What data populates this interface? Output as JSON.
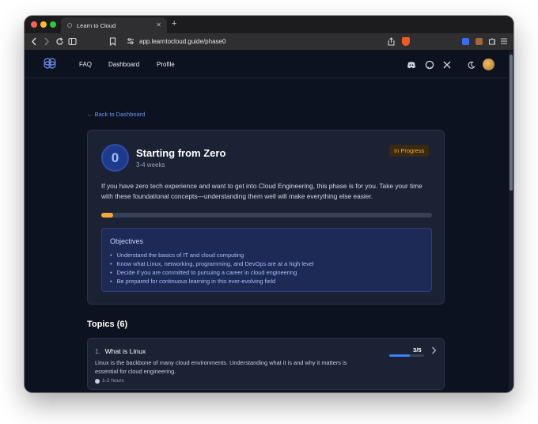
{
  "browser": {
    "tab_title": "Learn to Cloud",
    "url": "app.learntocloud.guide/phase0"
  },
  "nav": {
    "links": [
      "FAQ",
      "Dashboard",
      "Profile"
    ]
  },
  "page": {
    "back_link": "← Back to Dashboard",
    "phase": {
      "number": "0",
      "title": "Starting from Zero",
      "duration": "3-4 weeks",
      "status": "In Progress",
      "description": "If you have zero tech experience and want to get into Cloud Engineering, this phase is for you. Take your time with these foundational concepts—understanding them well will make everything else easier.",
      "progress": 0.035
    },
    "objectives": {
      "title": "Objectives",
      "items": [
        "Understand the basics of IT and cloud computing",
        "Know what Linux, networking, programming, and DevOps are at a high level",
        "Decide if you are committed to pursuing a career in cloud engineering",
        "Be prepared for continuous learning in this ever-evolving field"
      ]
    },
    "topics": {
      "heading": "Topics (6)",
      "items": [
        {
          "number": "1.",
          "title": "What is Linux",
          "description": "Linux is the backbone of many cloud environments. Understanding what it is and why it matters is essential for cloud engineering.",
          "time": "1-2 hours",
          "count": "3/5",
          "progress": 0.6
        }
      ]
    }
  },
  "colors": {
    "accent": "#f2a93b",
    "link": "#6b93f5",
    "background": "#0d1220",
    "card": "#1a2234"
  }
}
